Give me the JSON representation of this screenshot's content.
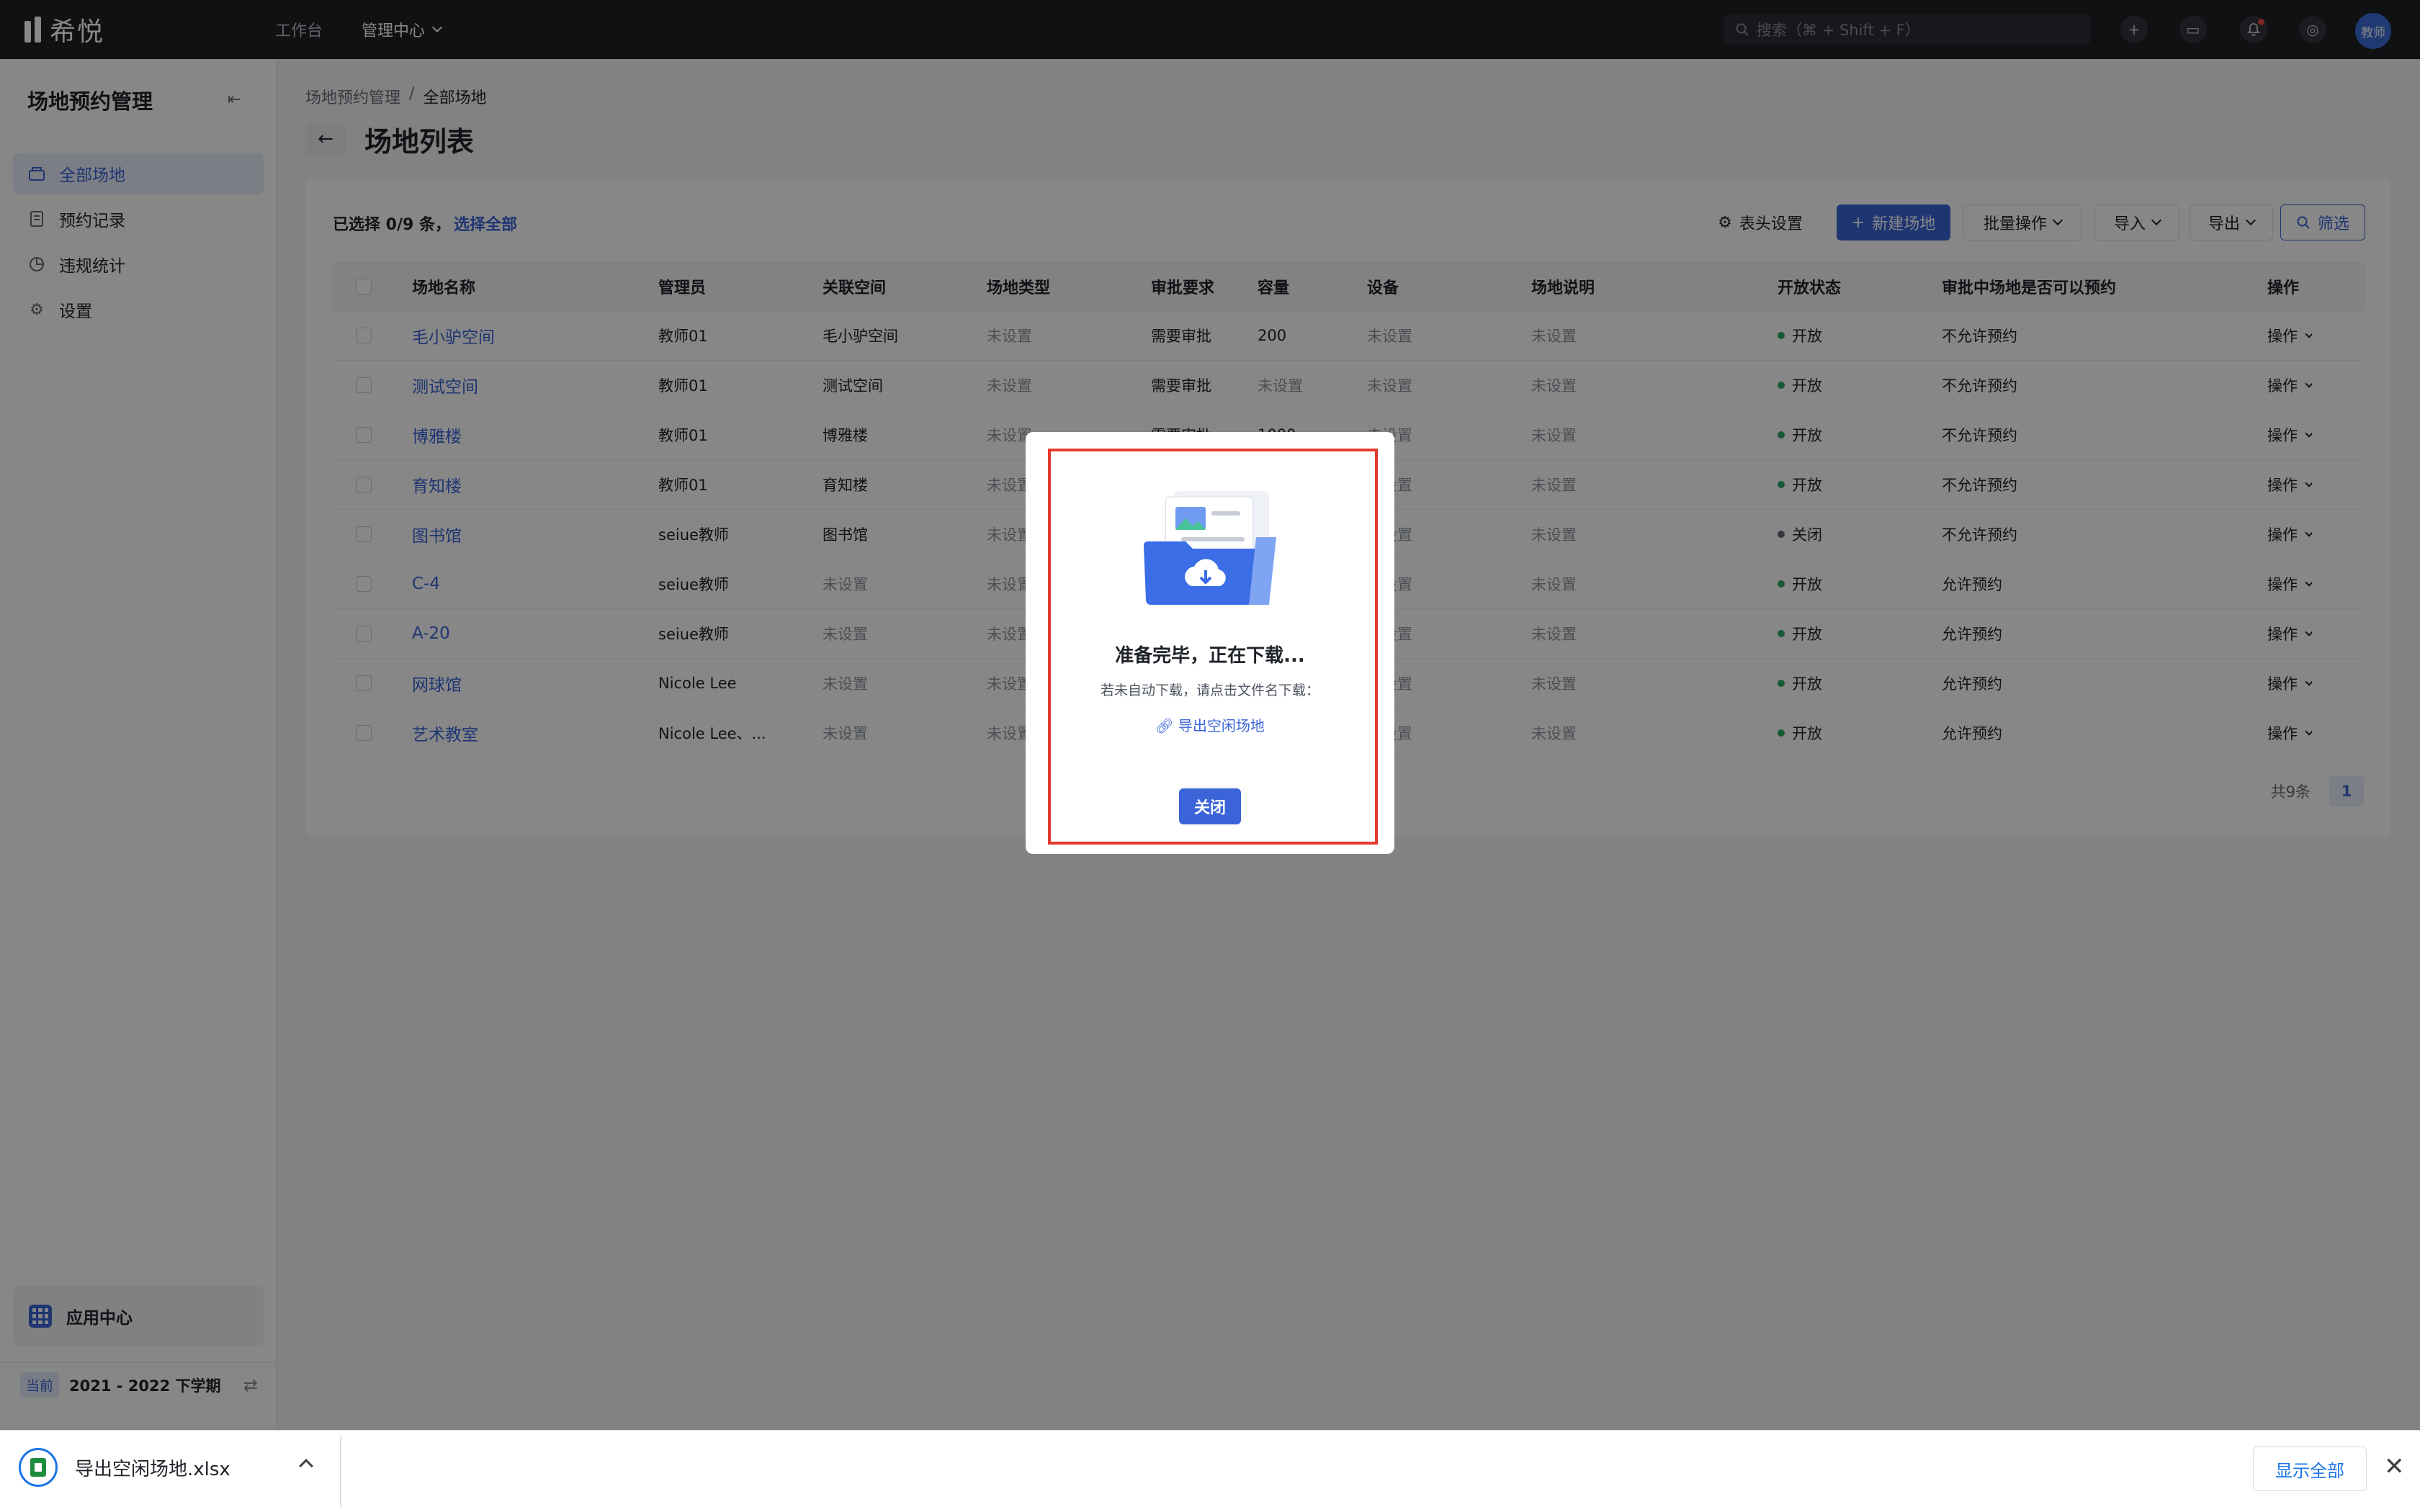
{
  "topbar": {
    "logo_text": "希悦",
    "nav": [
      {
        "label": "工作台"
      },
      {
        "label": "管理中心"
      }
    ],
    "search_placeholder": "搜索（⌘ + Shift + F）",
    "avatar_label": "教师"
  },
  "sidebar": {
    "title": "场地预约管理",
    "items": [
      {
        "label": "全部场地",
        "icon": "venue-icon",
        "active": true
      },
      {
        "label": "预约记录",
        "icon": "record-icon",
        "active": false
      },
      {
        "label": "违规统计",
        "icon": "pie-chart-icon",
        "active": false
      },
      {
        "label": "设置",
        "icon": "gear-icon",
        "active": false
      }
    ],
    "app_center": "应用中心",
    "term_badge": "当前",
    "term_text": "2021 - 2022 下学期"
  },
  "breadcrumb": {
    "parent": "场地预约管理",
    "sep": "/",
    "current": "全部场地"
  },
  "page_title": "场地列表",
  "toolbar": {
    "selected_text": "已选择 0/9 条，",
    "select_all": "选择全部",
    "column_settings": "表头设置",
    "new_venue": "新建场地",
    "batch": "批量操作",
    "import": "导入",
    "export": "导出",
    "filter": "筛选"
  },
  "table": {
    "headers": [
      "场地名称",
      "管理员",
      "关联空间",
      "场地类型",
      "审批要求",
      "容量",
      "设备",
      "场地说明",
      "开放状态",
      "审批中场地是否可以预约",
      "操作"
    ],
    "rows": [
      {
        "name": "毛小驴空间",
        "admin": "教师01",
        "space": "毛小驴空间",
        "type": "未设置",
        "approval": "需要审批",
        "capacity": "200",
        "equipment": "未设置",
        "desc": "未设置",
        "status": "开放",
        "allow": "不允许预约",
        "op": "操作"
      },
      {
        "name": "测试空间",
        "admin": "教师01",
        "space": "测试空间",
        "type": "未设置",
        "approval": "需要审批",
        "capacity": "未设置",
        "equipment": "未设置",
        "desc": "未设置",
        "status": "开放",
        "allow": "不允许预约",
        "op": "操作"
      },
      {
        "name": "博雅楼",
        "admin": "教师01",
        "space": "博雅楼",
        "type": "未设置",
        "approval": "需要审批",
        "capacity": "1000",
        "equipment": "未设置",
        "desc": "未设置",
        "status": "开放",
        "allow": "不允许预约",
        "op": "操作"
      },
      {
        "name": "育知楼",
        "admin": "教师01",
        "space": "育知楼",
        "type": "未设置",
        "approval": "",
        "capacity": "",
        "equipment": "未设置",
        "desc": "未设置",
        "status": "开放",
        "allow": "不允许预约",
        "op": "操作"
      },
      {
        "name": "图书馆",
        "admin": "seiue教师",
        "space": "图书馆",
        "type": "未设置",
        "approval": "",
        "capacity": "",
        "equipment": "未设置",
        "desc": "未设置",
        "status": "关闭",
        "allow": "不允许预约",
        "op": "操作"
      },
      {
        "name": "C-4",
        "admin": "seiue教师",
        "space": "未设置",
        "type": "未设置",
        "approval": "",
        "capacity": "",
        "equipment": "未设置",
        "desc": "未设置",
        "status": "开放",
        "allow": "允许预约",
        "op": "操作"
      },
      {
        "name": "A-20",
        "admin": "seiue教师",
        "space": "未设置",
        "type": "未设置",
        "approval": "",
        "capacity": "",
        "equipment": "未设置",
        "desc": "未设置",
        "status": "开放",
        "allow": "允许预约",
        "op": "操作"
      },
      {
        "name": "网球馆",
        "admin": "Nicole Lee",
        "space": "未设置",
        "type": "未设置",
        "approval": "",
        "capacity": "",
        "equipment": "未设置",
        "desc": "未设置",
        "status": "开放",
        "allow": "允许预约",
        "op": "操作"
      },
      {
        "name": "艺术教室",
        "admin": "Nicole Lee、...",
        "space": "未设置",
        "type": "未设置",
        "approval": "",
        "capacity": "",
        "equipment": "未设置",
        "desc": "未设置",
        "status": "开放",
        "allow": "允许预约",
        "op": "操作"
      }
    ],
    "total": "共9条",
    "page": "1"
  },
  "modal": {
    "title": "准备完毕，正在下载...",
    "hint": "若未自动下载，请点击文件名下载：",
    "file_link": "导出空闲场地",
    "close": "关闭"
  },
  "download_bar": {
    "filename": "导出空闲场地.xlsx",
    "show_all": "显示全部"
  },
  "colors": {
    "accent": "#3a64d8",
    "open_dot": "#2fa866",
    "closed_dot": "#646a73",
    "highlight_border": "#e33a2e"
  }
}
